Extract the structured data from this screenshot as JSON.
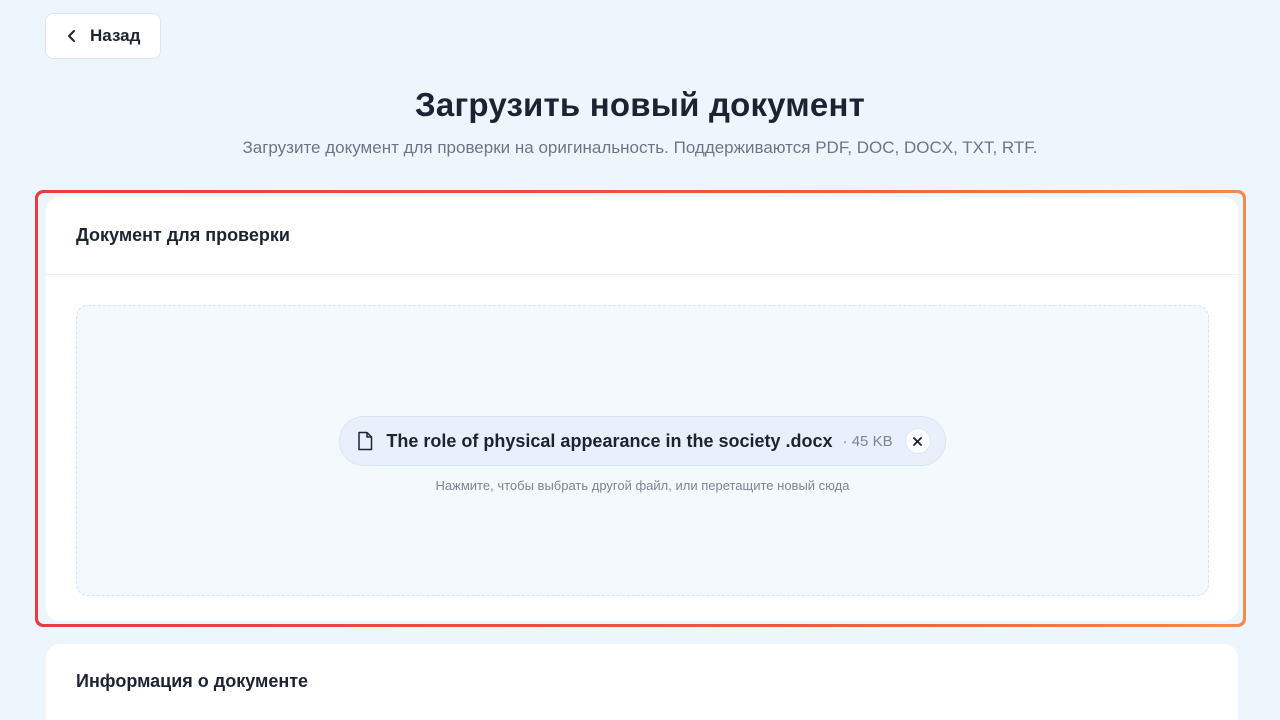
{
  "back": {
    "label": "Назад",
    "icon": "chevron-left-icon"
  },
  "header": {
    "title": "Загрузить новый документ",
    "subtitle": "Загрузите документ для проверки на оригинальность. Поддерживаются PDF, DOC, DOCX, TXT, RTF."
  },
  "upload_card": {
    "title": "Документ для проверки",
    "file": {
      "icon": "file-icon",
      "name": "The role of physical appearance in the society .docx",
      "size": "45 KB",
      "remove_icon": "close-icon"
    },
    "hint": "Нажмите, чтобы выбрать другой файл, или перетащите новый сюда"
  },
  "info_card": {
    "title": "Информация о документе"
  },
  "colors": {
    "background": "#eef6fd",
    "highlight_start": "#ec3a42",
    "highlight_end": "#f28b4f",
    "text_primary": "#1c2433",
    "text_muted": "#6c7686"
  }
}
